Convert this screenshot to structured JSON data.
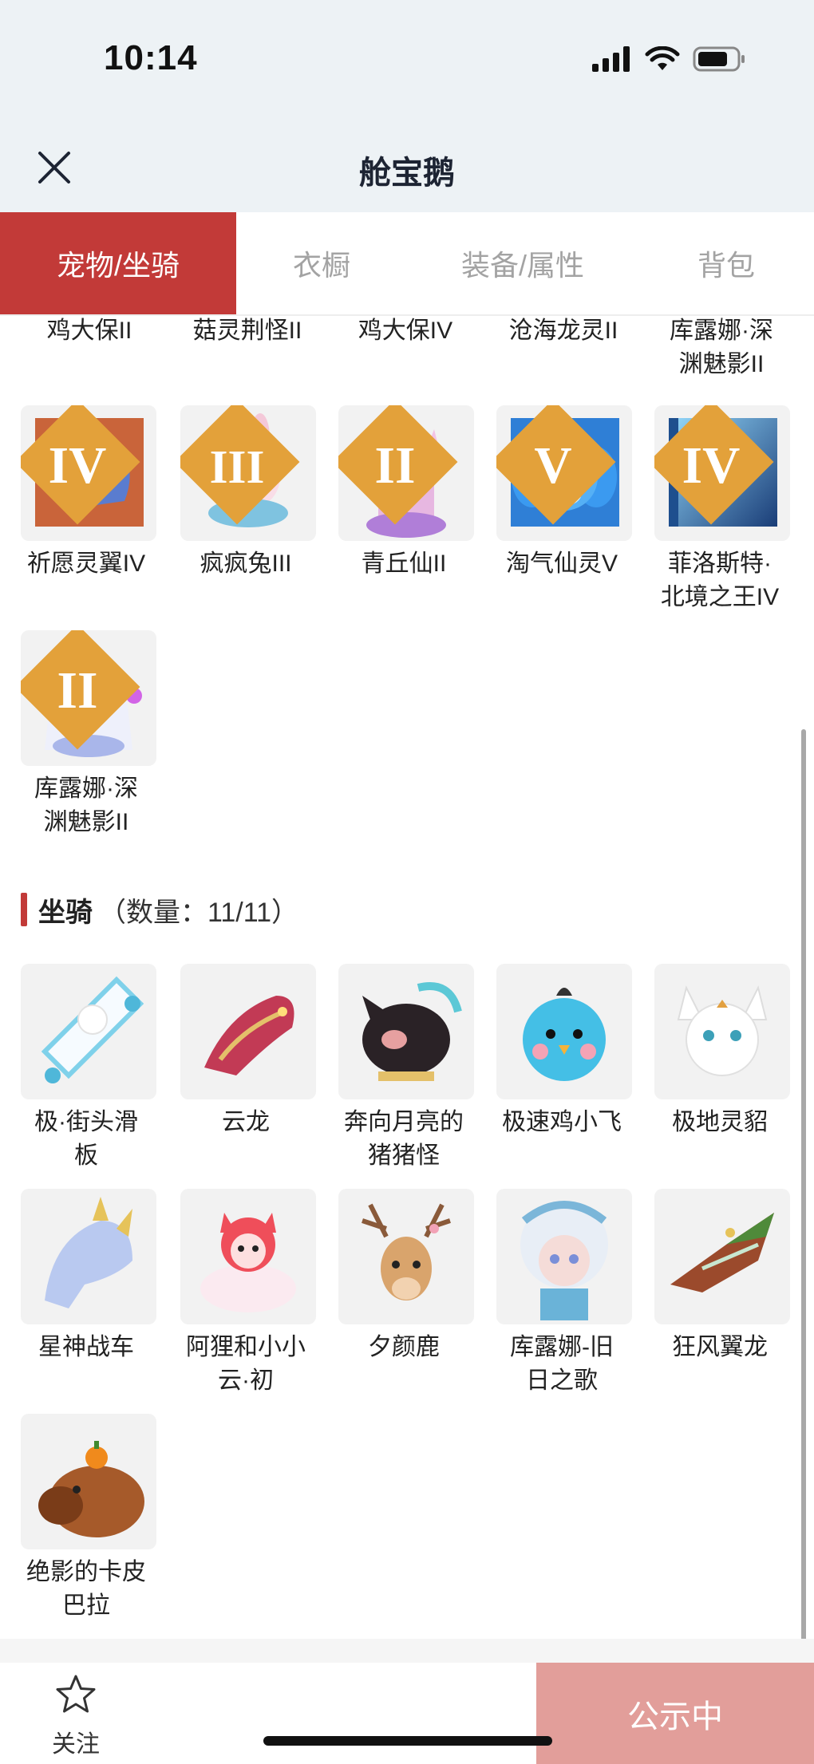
{
  "status": {
    "time": "10:14"
  },
  "header": {
    "title": "舱宝鹅"
  },
  "tabs": [
    {
      "label": "宠物/坐骑",
      "active": true
    },
    {
      "label": "衣橱",
      "active": false
    },
    {
      "label": "装备/属性",
      "active": false
    },
    {
      "label": "背包",
      "active": false
    }
  ],
  "pets": {
    "top_labels": [
      "鸡大保II",
      "菇灵荆怪II",
      "鸡大保IV",
      "沧海龙灵II",
      "库露娜·深\n渊魅影II"
    ],
    "items": [
      {
        "name": "祈愿灵翼IV",
        "rank": "IV",
        "icon": "bird-icon"
      },
      {
        "name": "疯疯兔III",
        "rank": "III",
        "icon": "rabbit-icon"
      },
      {
        "name": "青丘仙II",
        "rank": "II",
        "icon": "fox-fairy-icon"
      },
      {
        "name": "淘气仙灵V",
        "rank": "V",
        "icon": "blue-pup-icon"
      },
      {
        "name": "菲洛斯特·\n北境之王IV",
        "rank": "IV",
        "icon": "ice-king-icon"
      },
      {
        "name": "库露娜·深\n渊魅影II",
        "rank": "II",
        "icon": "doll-icon"
      }
    ]
  },
  "mounts": {
    "title": "坐骑",
    "count": "（数量：11/11）",
    "items": [
      {
        "name": "极·街头滑\n板",
        "icon": "skateboard-icon"
      },
      {
        "name": "云龙",
        "icon": "dragon-icon"
      },
      {
        "name": "奔向月亮的\n猪猪怪",
        "icon": "pig-icon"
      },
      {
        "name": "极速鸡小飞",
        "icon": "chick-icon"
      },
      {
        "name": "极地灵貂",
        "icon": "mink-icon"
      },
      {
        "name": "星神战车",
        "icon": "horse-icon"
      },
      {
        "name": "阿狸和小小\n云·初",
        "icon": "fox-cloud-icon"
      },
      {
        "name": "夕颜鹿",
        "icon": "deer-icon"
      },
      {
        "name": "库露娜-旧\n日之歌",
        "icon": "girl-icon"
      },
      {
        "name": "狂风翼龙",
        "icon": "wyvern-icon"
      },
      {
        "name": "绝影的卡皮\n巴拉",
        "icon": "capybara-icon"
      }
    ]
  },
  "bottom": {
    "follow_label": "关注",
    "public_label": "公示中"
  },
  "colors": {
    "accent": "#c23a38",
    "public_button": "#e29e9a",
    "header_bg": "#edf2f5"
  }
}
